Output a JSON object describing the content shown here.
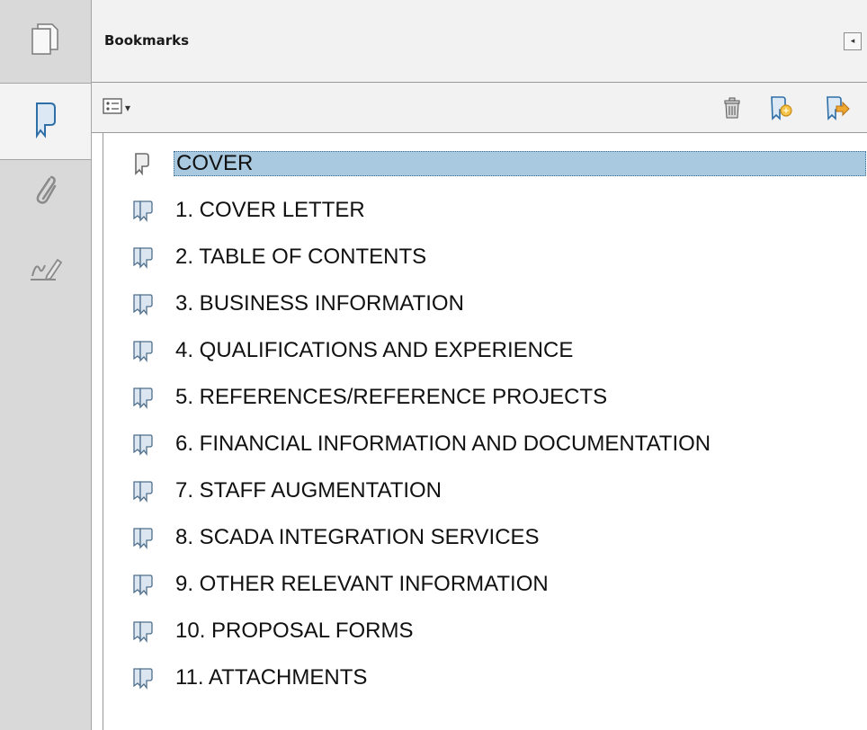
{
  "panel": {
    "title": "Bookmarks",
    "collapse_glyph": "◂"
  },
  "rail": {
    "items": [
      {
        "name": "pages-icon"
      },
      {
        "name": "bookmarks-icon",
        "active": true
      },
      {
        "name": "attachments-icon"
      },
      {
        "name": "signatures-icon"
      }
    ]
  },
  "toolbar": {
    "options_icon": "options-menu-icon",
    "options_caret": "▾",
    "delete_icon": "trash-icon",
    "new_bookmark_icon": "new-bookmark-icon",
    "promote_icon": "bookmark-arrow-icon"
  },
  "bookmarks": [
    {
      "label": "COVER",
      "selected": true,
      "icon": "bookmark-icon"
    },
    {
      "label": "1. COVER LETTER",
      "icon": "bookmark-multi-icon"
    },
    {
      "label": "2. TABLE OF CONTENTS",
      "icon": "bookmark-multi-icon"
    },
    {
      "label": "3. BUSINESS INFORMATION",
      "icon": "bookmark-multi-icon"
    },
    {
      "label": "4. QUALIFICATIONS AND EXPERIENCE",
      "icon": "bookmark-multi-icon"
    },
    {
      "label": "5. REFERENCES/REFERENCE PROJECTS",
      "icon": "bookmark-multi-icon"
    },
    {
      "label": "6. FINANCIAL INFORMATION AND DOCUMENTATION",
      "icon": "bookmark-multi-icon"
    },
    {
      "label": "7. STAFF AUGMENTATION",
      "icon": "bookmark-multi-icon"
    },
    {
      "label": "8. SCADA INTEGRATION SERVICES",
      "icon": "bookmark-multi-icon"
    },
    {
      "label": "9. OTHER RELEVANT INFORMATION",
      "icon": "bookmark-multi-icon"
    },
    {
      "label": "10. PROPOSAL FORMS",
      "icon": "bookmark-multi-icon"
    },
    {
      "label": "11. ATTACHMENTS",
      "icon": "bookmark-multi-icon"
    }
  ],
  "colors": {
    "selection": "#a8c9e0",
    "rail": "#d9d9d9",
    "header": "#f2f2f2"
  }
}
